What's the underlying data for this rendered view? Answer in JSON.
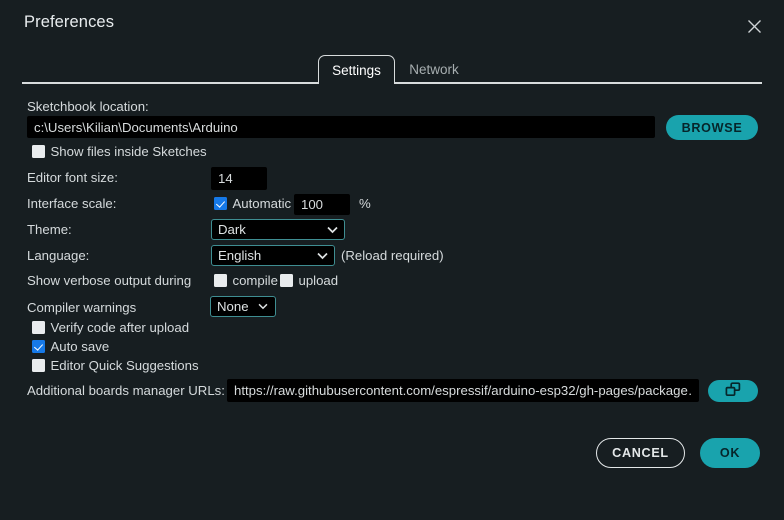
{
  "window": {
    "title": "Preferences",
    "close_icon": "close-icon"
  },
  "tabs": [
    {
      "label": "Settings",
      "active": true
    },
    {
      "label": "Network",
      "active": false
    }
  ],
  "settings": {
    "sketchbook": {
      "label": "Sketchbook location:",
      "value": "c:\\Users\\Kilian\\Documents\\Arduino",
      "browse_label": "BROWSE"
    },
    "show_files_inside_sketches": {
      "label": "Show files inside Sketches",
      "checked": false
    },
    "editor_font_size": {
      "label": "Editor font size:",
      "value": "14"
    },
    "interface_scale": {
      "label": "Interface scale:",
      "automatic_label": "Automatic",
      "automatic_checked": true,
      "value": "100",
      "unit": "%"
    },
    "theme": {
      "label": "Theme:",
      "value": "Dark"
    },
    "language": {
      "label": "Language:",
      "value": "English",
      "note": "(Reload required)"
    },
    "verbose_output": {
      "label": "Show verbose output during",
      "compile_label": "compile",
      "compile_checked": false,
      "upload_label": "upload",
      "upload_checked": false
    },
    "compiler_warnings": {
      "label": "Compiler warnings",
      "value": "None"
    },
    "verify_code_after_upload": {
      "label": "Verify code after upload",
      "checked": false
    },
    "auto_save": {
      "label": "Auto save",
      "checked": true
    },
    "editor_quick_suggestions": {
      "label": "Editor Quick Suggestions",
      "checked": false
    },
    "boards_manager_urls": {
      "label": "Additional boards manager URLs:",
      "value": "https://raw.githubusercontent.com/espressif/arduino-esp32/gh-pages/package…",
      "expand_icon": "open-windows-icon"
    }
  },
  "footer": {
    "cancel_label": "CANCEL",
    "ok_label": "OK"
  },
  "colors": {
    "background": "#171e21",
    "accent": "#19a3ad",
    "input_background": "#000000",
    "checkbox_checked": "#1679e8",
    "select_border": "#3f8e92",
    "text": "#d5dadc"
  }
}
